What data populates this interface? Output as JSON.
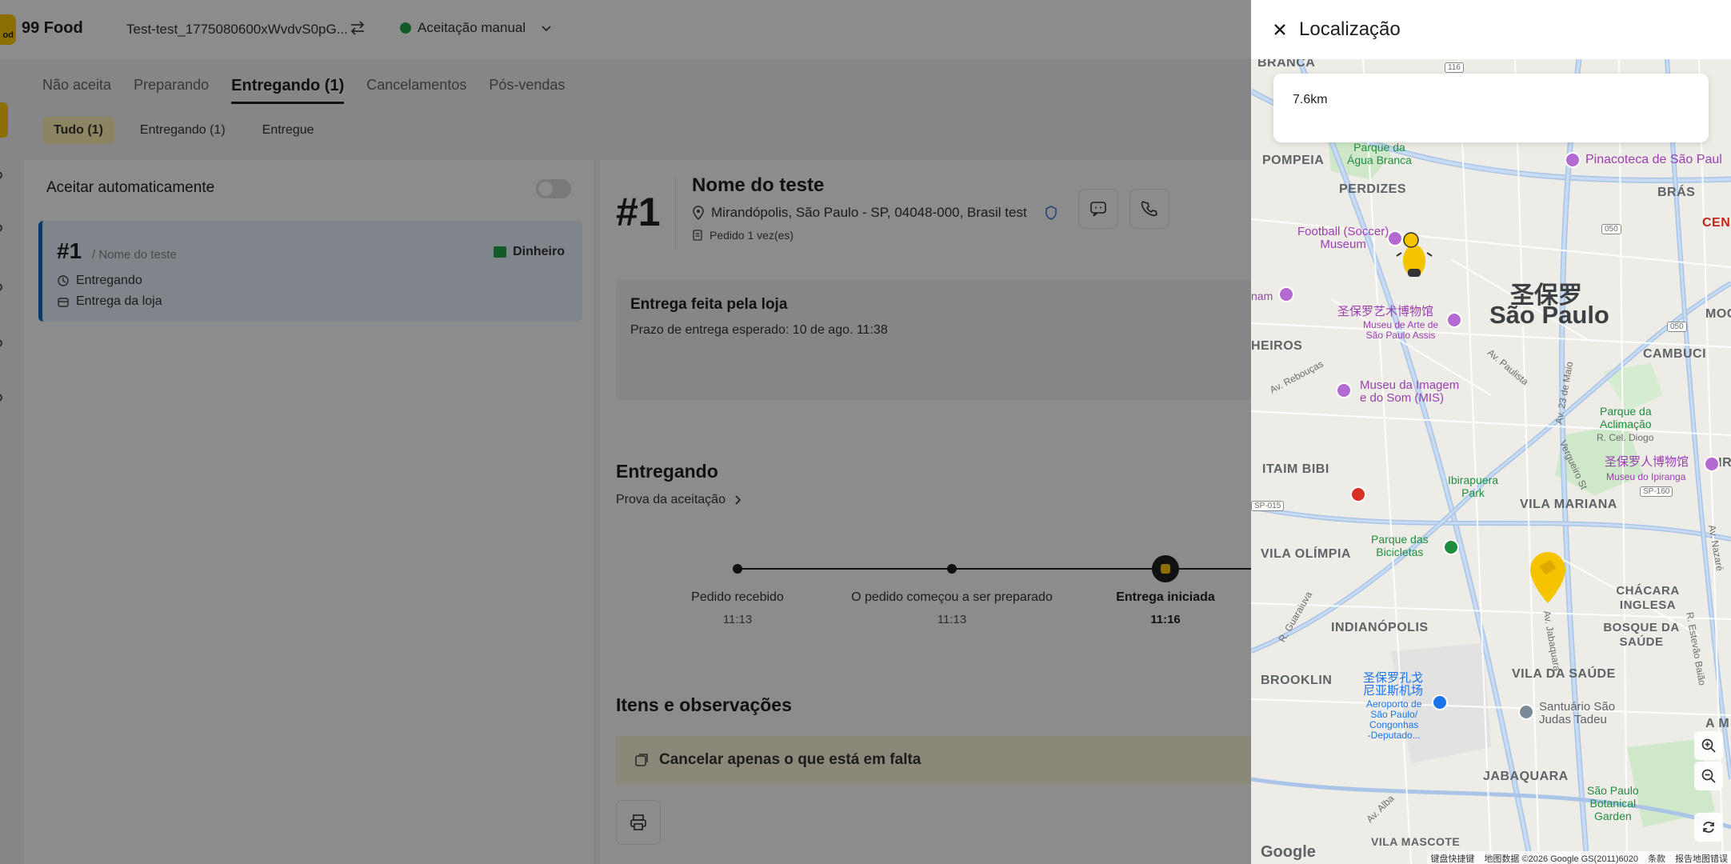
{
  "header": {
    "logo_text": "od",
    "brand": "99 Food",
    "store_name": "Test-test_1775080600xWvdvS0pG...",
    "status": "Aceitação manual"
  },
  "tabs": [
    {
      "label": "Não aceita"
    },
    {
      "label": "Preparando"
    },
    {
      "label": "Entregando (1)",
      "active": true
    },
    {
      "label": "Cancelamentos"
    },
    {
      "label": "Pós-vendas"
    }
  ],
  "filters": [
    {
      "label": "Tudo (1)",
      "active": true
    },
    {
      "label": "Entregando (1)"
    },
    {
      "label": "Entregue"
    }
  ],
  "list": {
    "auto_accept_label": "Aceitar automaticamente",
    "order_card": {
      "number": "#1",
      "customer": "/ Nome do teste",
      "payment": "Dinheiro",
      "status": "Entregando",
      "delivery_type": "Entrega da loja"
    }
  },
  "detail": {
    "number": "#1",
    "customer_name": "Nome do teste",
    "address": "Mirandópolis, São Paulo - SP, 04048-000, Brasil test",
    "order_count": "Pedido 1 vez(es)",
    "delivery_title": "Entrega feita pela loja",
    "delivery_deadline": "Prazo de entrega esperado: 10 de ago. 11:38",
    "status_section_title": "Entregando",
    "proof_link": "Prova da aceitação",
    "timeline": [
      {
        "label": "Pedido recebido",
        "time": "11:13"
      },
      {
        "label": "O pedido começou a ser preparado",
        "time": "11:13"
      },
      {
        "label": "Entrega iniciada",
        "time": "11:16",
        "current": true
      }
    ],
    "items_title": "Itens e observações",
    "cancel_missing": "Cancelar apenas o que está em falta"
  },
  "drawer": {
    "title": "Localização",
    "distance": "7.6km",
    "map": {
      "neighborhoods": [
        "BRANCA",
        "POMPEIA",
        "PERDIZES",
        "BRÁS",
        "HEIROS",
        "CAMBUCI",
        "ITAIM BIBI",
        "VILA MARIANA",
        "VILA OLÍMPIA",
        "CHÁCARA INGLESA",
        "INDIANÓPOLIS",
        "BOSQUE DA SAÚDE",
        "BROOKLIN",
        "VILA DA SAÚDE",
        "JABAQUARA",
        "VILA MASCOTE",
        "CEN",
        "MOC",
        "IPIR",
        "A M"
      ],
      "city_cn": "圣保罗",
      "city": "São Paulo",
      "pois": {
        "parque_agua_branca": "Parque da\nÁgua Branca",
        "pinacoteca": "Pinacoteca de São Paul",
        "football_museum": "Football (Soccer)\nMuseum",
        "masp_cn": "圣保罗艺术博物馆",
        "masp": "Museu de Arte de\nSão Paulo Assis",
        "mis": "Museu da Imagem\ne do Som (MIS)",
        "parque_aclimacao": "Parque da\nAclimação",
        "ipiranga_cn": "圣保罗人博物馆",
        "ipiranga": "Museu do Ipiranga",
        "ibirapuera": "Ibirapuera\nPark",
        "bicicletas": "Parque das\nBicicletas",
        "airport_cn": "圣保罗孔戈\n尼亚斯机场",
        "airport": "Aeroporto de\nSão Paulo/\nCongonhas\n-Deputado...",
        "santuario": "Santuário São\nJudas Tadeu",
        "botanical": "São Paulo\nBotanical\nGarden",
        "mam": "nam"
      },
      "streets": [
        "Av. Rebouças",
        "Av. Paulista",
        "Av. 23 de Maio",
        "R. Cel. Diogo",
        "Vergueiro St",
        "Av. Nazaré",
        "R. Guaraiuva",
        "R. Estevão Baião",
        "Av. Jabaquara",
        "Av. Alba",
        "R. Cel. Diogo"
      ],
      "road_shields": [
        "116",
        "050",
        "050",
        "SP-160",
        "SP-015"
      ],
      "attribution": [
        "键盘快捷键",
        "地图数据 ©2026 Google GS(2011)6020",
        "条款",
        "报告地图错误"
      ],
      "google": "Google"
    }
  }
}
